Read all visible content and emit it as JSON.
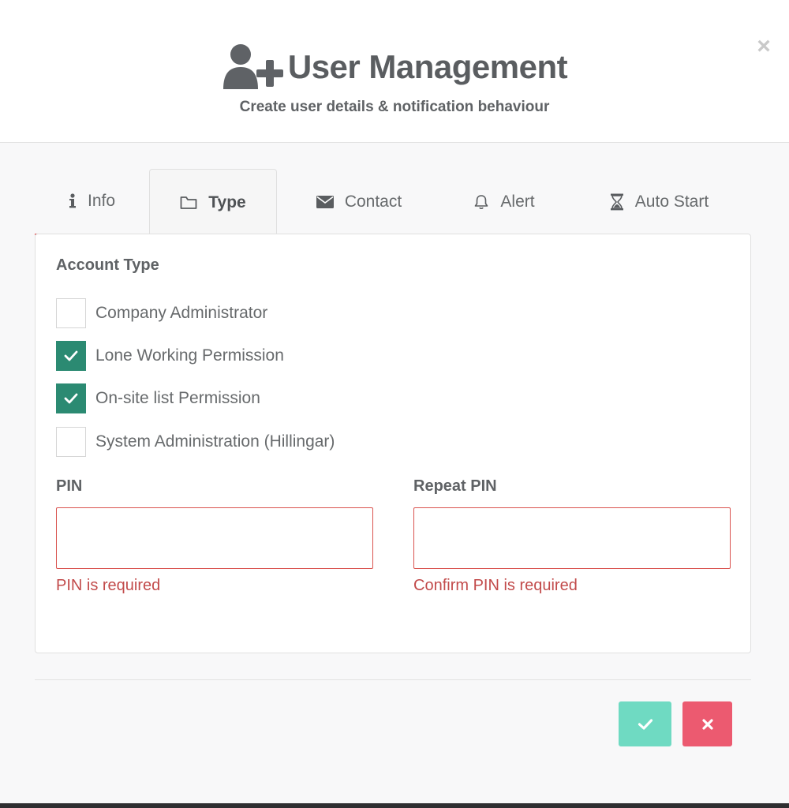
{
  "header": {
    "title": "User Management",
    "subtitle": "Create user details & notification behaviour",
    "close_label": "×",
    "icon": "user-plus-icon"
  },
  "tabs": [
    {
      "label": "Info",
      "icon": "info-icon",
      "active": false
    },
    {
      "label": "Type",
      "icon": "folder-icon",
      "active": true
    },
    {
      "label": "Contact",
      "icon": "envelope-icon",
      "active": false
    },
    {
      "label": "Alert",
      "icon": "bell-icon",
      "active": false
    },
    {
      "label": "Auto Start",
      "icon": "hourglass-icon",
      "active": false
    }
  ],
  "account_type": {
    "heading": "Account Type",
    "options": [
      {
        "label": "Company Administrator",
        "checked": false
      },
      {
        "label": "Lone Working Permission",
        "checked": true
      },
      {
        "label": "On-site list Permission",
        "checked": true
      },
      {
        "label": "System Administration (Hillingar)",
        "checked": false
      }
    ]
  },
  "pin": {
    "label": "PIN",
    "value": "",
    "error": "PIN is required"
  },
  "repeat_pin": {
    "label": "Repeat PIN",
    "value": "",
    "error": "Confirm PIN is required"
  },
  "colors": {
    "checked": "#2b8a72",
    "error": "#c24b4b",
    "confirm_button": "#6fdac2",
    "cancel_button": "#ec5a70"
  }
}
